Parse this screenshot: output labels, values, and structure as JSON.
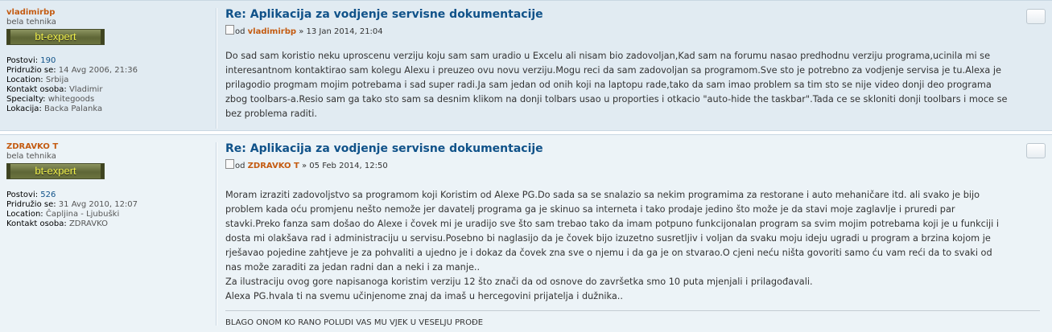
{
  "posts": [
    {
      "username": "vladimirbp",
      "rank_title": "bela tehnika",
      "rank_badge": "bt-expert",
      "profile": [
        {
          "label": "Postovi:",
          "value": "190",
          "link": true
        },
        {
          "label": "Pridružio se:",
          "value": "14 Avg 2006, 21:36"
        },
        {
          "label": "Location:",
          "value": "Srbija"
        },
        {
          "label": "Kontakt osoba:",
          "value": "Vladimir"
        },
        {
          "label": "Specialty:",
          "value": "whitegoods"
        },
        {
          "label": "Lokacija:",
          "value": "Backa Palanka"
        }
      ],
      "title": "Re: Aplikacija za vodjenje servisne dokumentacije",
      "author_prefix": "od",
      "author_name": "vladimirbp",
      "author_date": "» 13 Jan 2014, 21:04",
      "lines": [
        "Do sad sam koristio neku uproscenu verziju koju sam sam uradio u Excelu ali nisam bio zadovoljan,Kad sam na forumu nasao predhodnu verziju programa,ucinila mi se",
        "interesantnom kontaktirao sam kolegu Alexu i preuzeo ovu novu verziju.Mogu reci da sam zadovoljan sa programom.Sve sto je potrebno za vodjenje servisa je tu.Alexa je",
        "prilagodio progmam mojim potrebama i sad super radi.Ja sam jedan od onih koji na laptopu rade,tako da sam imao problem sa tim sto se nije video donji deo programa",
        "zbog toolbars-a.Resio sam ga tako sto sam sa desnim klikom na donji tolbars usao u proporties i otkacio \"auto-hide the taskbar\".Tada ce se skloniti donji toolbars i moce se",
        "bez problema raditi."
      ]
    },
    {
      "username": "ZDRAVKO T",
      "rank_title": "bela tehnika",
      "rank_badge": "bt-expert",
      "profile": [
        {
          "label": "Postovi:",
          "value": "526",
          "link": true
        },
        {
          "label": "Pridružio se:",
          "value": "31 Avg 2010, 12:07"
        },
        {
          "label": "Location:",
          "value": "Čapljina - Ljubuški"
        },
        {
          "label": "Kontakt osoba:",
          "value": "ZDRAVKO"
        }
      ],
      "title": "Re: Aplikacija za vodjenje servisne dokumentacije",
      "author_prefix": "od",
      "author_name": "ZDRAVKO T",
      "author_date": "» 05 Feb 2014, 12:50",
      "lines": [
        "Moram izraziti zadovoljstvo sa programom koji Koristim od Alexe PG.Do sada sa se snalazio sa nekim programima za restorane i auto mehaničare itd.  ali svako je bijo",
        "problem kada oću promjenu nešto nemože jer davatelj programa ga je skinuo sa interneta i tako prodaje jedino što može je da stavi moje zaglavlje i pruredi par",
        "stavki.Preko fanza sam došao do Alexe i čovek mi je uradijo sve što sam trebao tako da imam potpuno funkcijonalan program sa svim mojim potrebama koji je u funkciji i",
        "dosta mi olakšava rad i administraciju u servisu.Posebno bi naglasijo da je čovek bijo izuzetno susretljiv i voljan da svaku moju ideju ugradi u program a brzina kojom je",
        "rješavao pojedine zahtjeve je za pohvaliti a ujedno je i dokaz da čovek zna sve o njemu i da ga je on stvarao.O cjeni neću ništa govoriti samo ću vam reći da to svaki od",
        "nas može zaraditi za jedan radni dan a neki i za manje..",
        "Za ilustraciju ovog gore napisanoga koristim verziju 12 što znači da od osnove do završetka smo 10 puta mjenjali i prilagođavali.",
        "Alexa PG.hvala ti na svemu učinjenome znaj da imaš u hercegovini prijatelja i dužnika.."
      ],
      "signature": "BLAGO ONOM KO RANO POLUDI VAS MU VJEK U VESELJU PROĐE"
    }
  ]
}
